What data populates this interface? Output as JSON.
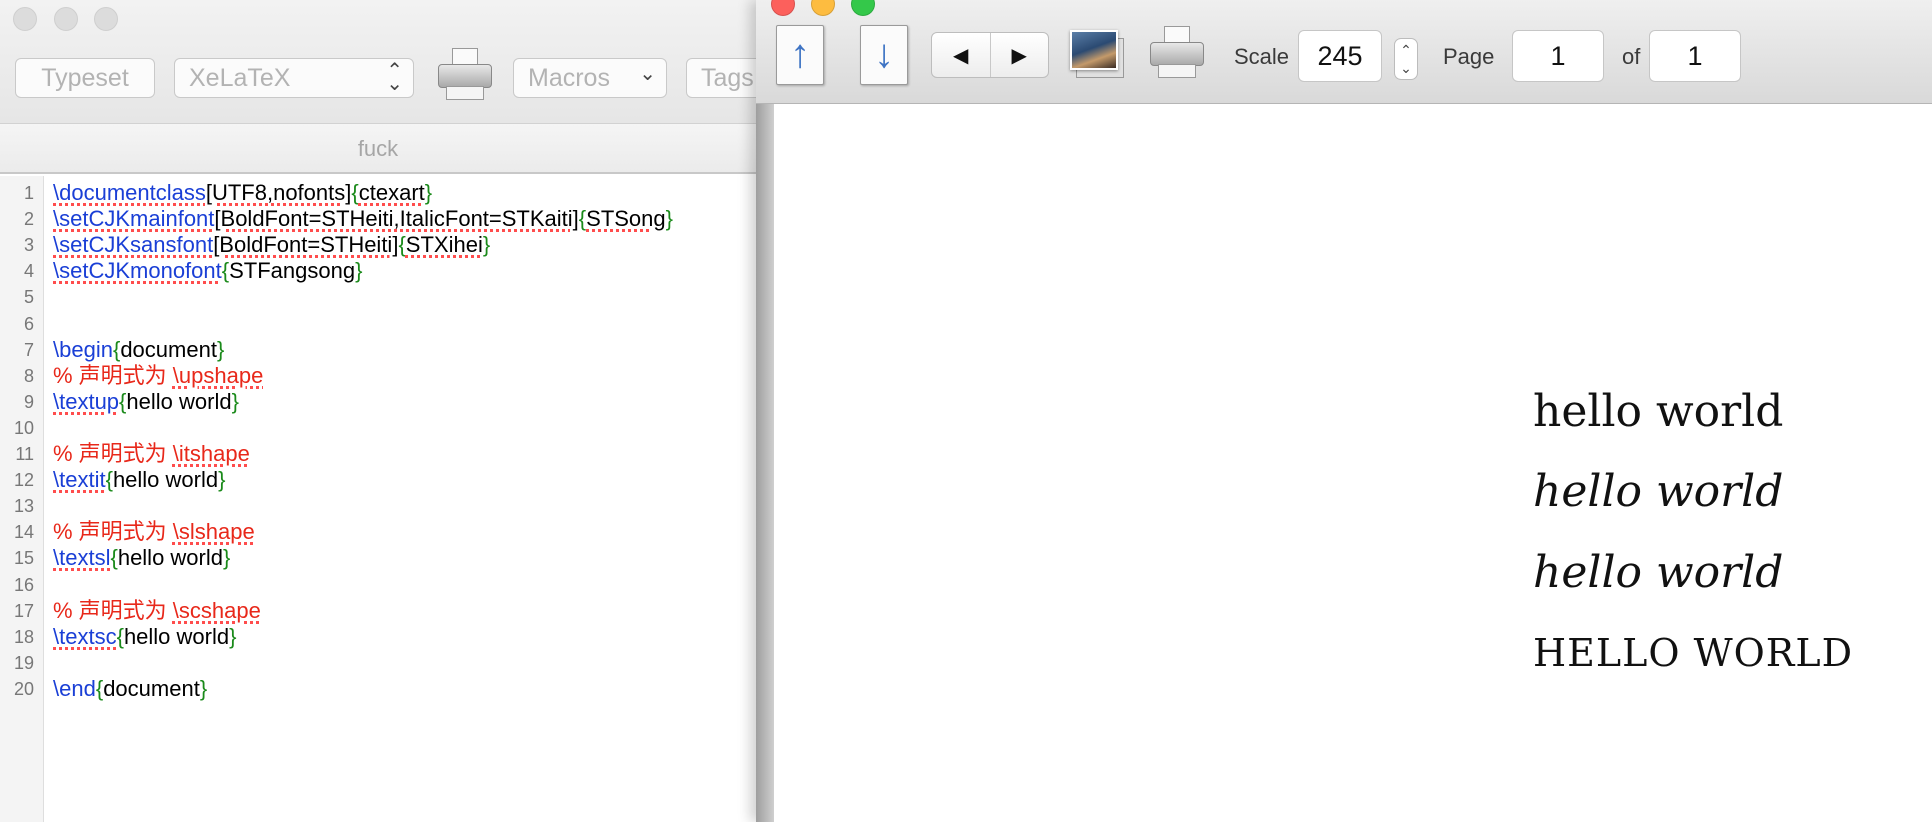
{
  "editor": {
    "toolbar": {
      "typeset_label": "Typeset",
      "engine_value": "XeLaTeX",
      "macros_label": "Macros",
      "tags_label": "Tags"
    },
    "document_title": "fuck",
    "lines": [
      {
        "n": "1",
        "parts": [
          {
            "t": "\\documentclass",
            "c": "cmd",
            "s": 1
          },
          {
            "t": "[UTF8,nofonts]",
            "c": "plain",
            "s": 1
          },
          {
            "t": "{",
            "c": "br"
          },
          {
            "t": "ctexart",
            "c": "plain",
            "s": 1
          },
          {
            "t": "}",
            "c": "br"
          }
        ]
      },
      {
        "n": "2",
        "parts": [
          {
            "t": "\\setCJKmainfont",
            "c": "cmd",
            "s": 1
          },
          {
            "t": "[BoldFont=STHeiti,ItalicFont=STKaiti]",
            "c": "plain",
            "s": 1
          },
          {
            "t": "{",
            "c": "br"
          },
          {
            "t": "STSong",
            "c": "plain",
            "s": 1
          },
          {
            "t": "}",
            "c": "br"
          }
        ]
      },
      {
        "n": "3",
        "parts": [
          {
            "t": "\\setCJKsansfont",
            "c": "cmd",
            "s": 1
          },
          {
            "t": "[BoldFont=STHeiti]",
            "c": "plain",
            "s": 1
          },
          {
            "t": "{",
            "c": "br"
          },
          {
            "t": "STXihei",
            "c": "plain",
            "s": 1
          },
          {
            "t": "}",
            "c": "br"
          }
        ]
      },
      {
        "n": "4",
        "parts": [
          {
            "t": "\\setCJKmonofont",
            "c": "cmd",
            "s": 1
          },
          {
            "t": "{",
            "c": "br"
          },
          {
            "t": "STFangsong",
            "c": "plain"
          },
          {
            "t": "}",
            "c": "br"
          }
        ]
      },
      {
        "n": "5",
        "parts": []
      },
      {
        "n": "6",
        "parts": []
      },
      {
        "n": "7",
        "parts": [
          {
            "t": "\\begin",
            "c": "cmd"
          },
          {
            "t": "{",
            "c": "br"
          },
          {
            "t": "document",
            "c": "plain"
          },
          {
            "t": "}",
            "c": "br"
          }
        ]
      },
      {
        "n": "8",
        "parts": [
          {
            "t": "% 声明式为 ",
            "c": "cmt"
          },
          {
            "t": "\\upshape",
            "c": "cmt",
            "s": 1
          }
        ]
      },
      {
        "n": "9",
        "parts": [
          {
            "t": "\\textup",
            "c": "cmd",
            "s": 1
          },
          {
            "t": "{",
            "c": "br"
          },
          {
            "t": "hello world",
            "c": "plain"
          },
          {
            "t": "}",
            "c": "br"
          }
        ]
      },
      {
        "n": "10",
        "parts": []
      },
      {
        "n": "11",
        "parts": [
          {
            "t": "% 声明式为 ",
            "c": "cmt"
          },
          {
            "t": "\\itshape",
            "c": "cmt",
            "s": 1
          }
        ]
      },
      {
        "n": "12",
        "parts": [
          {
            "t": "\\textit",
            "c": "cmd",
            "s": 1
          },
          {
            "t": "{",
            "c": "br"
          },
          {
            "t": "hello world",
            "c": "plain"
          },
          {
            "t": "}",
            "c": "br"
          }
        ]
      },
      {
        "n": "13",
        "parts": []
      },
      {
        "n": "14",
        "parts": [
          {
            "t": "% 声明式为 ",
            "c": "cmt"
          },
          {
            "t": "\\slshape",
            "c": "cmt",
            "s": 1
          }
        ]
      },
      {
        "n": "15",
        "parts": [
          {
            "t": "\\textsl",
            "c": "cmd",
            "s": 1
          },
          {
            "t": "{",
            "c": "br"
          },
          {
            "t": "hello world",
            "c": "plain"
          },
          {
            "t": "}",
            "c": "br"
          }
        ]
      },
      {
        "n": "16",
        "parts": []
      },
      {
        "n": "17",
        "parts": [
          {
            "t": "% 声明式为 ",
            "c": "cmt"
          },
          {
            "t": "\\scshape",
            "c": "cmt",
            "s": 1
          }
        ]
      },
      {
        "n": "18",
        "parts": [
          {
            "t": "\\textsc",
            "c": "cmd",
            "s": 1
          },
          {
            "t": "{",
            "c": "br"
          },
          {
            "t": "hello world",
            "c": "plain"
          },
          {
            "t": "}",
            "c": "br"
          }
        ]
      },
      {
        "n": "19",
        "parts": []
      },
      {
        "n": "20",
        "parts": [
          {
            "t": "\\end",
            "c": "cmd"
          },
          {
            "t": "{",
            "c": "br"
          },
          {
            "t": "document",
            "c": "plain"
          },
          {
            "t": "}",
            "c": "br"
          }
        ]
      }
    ]
  },
  "preview": {
    "toolbar": {
      "scale_label": "Scale",
      "scale_value": "245",
      "page_label": "Page",
      "page_value": "1",
      "of_label": "of",
      "total_pages": "1"
    },
    "output_lines": [
      {
        "text": "hello world",
        "style": "up"
      },
      {
        "text": "hello world",
        "style": "it"
      },
      {
        "text": "hello world",
        "style": "sl"
      },
      {
        "text": "HELLO WORLD",
        "style": "sc"
      }
    ]
  },
  "colors": {
    "command": "#1a3fd6",
    "brace": "#1a8a1a",
    "comment": "#e8281a",
    "traffic_close": "#fc605c",
    "traffic_min": "#fdbc40",
    "traffic_max": "#34c84a"
  }
}
